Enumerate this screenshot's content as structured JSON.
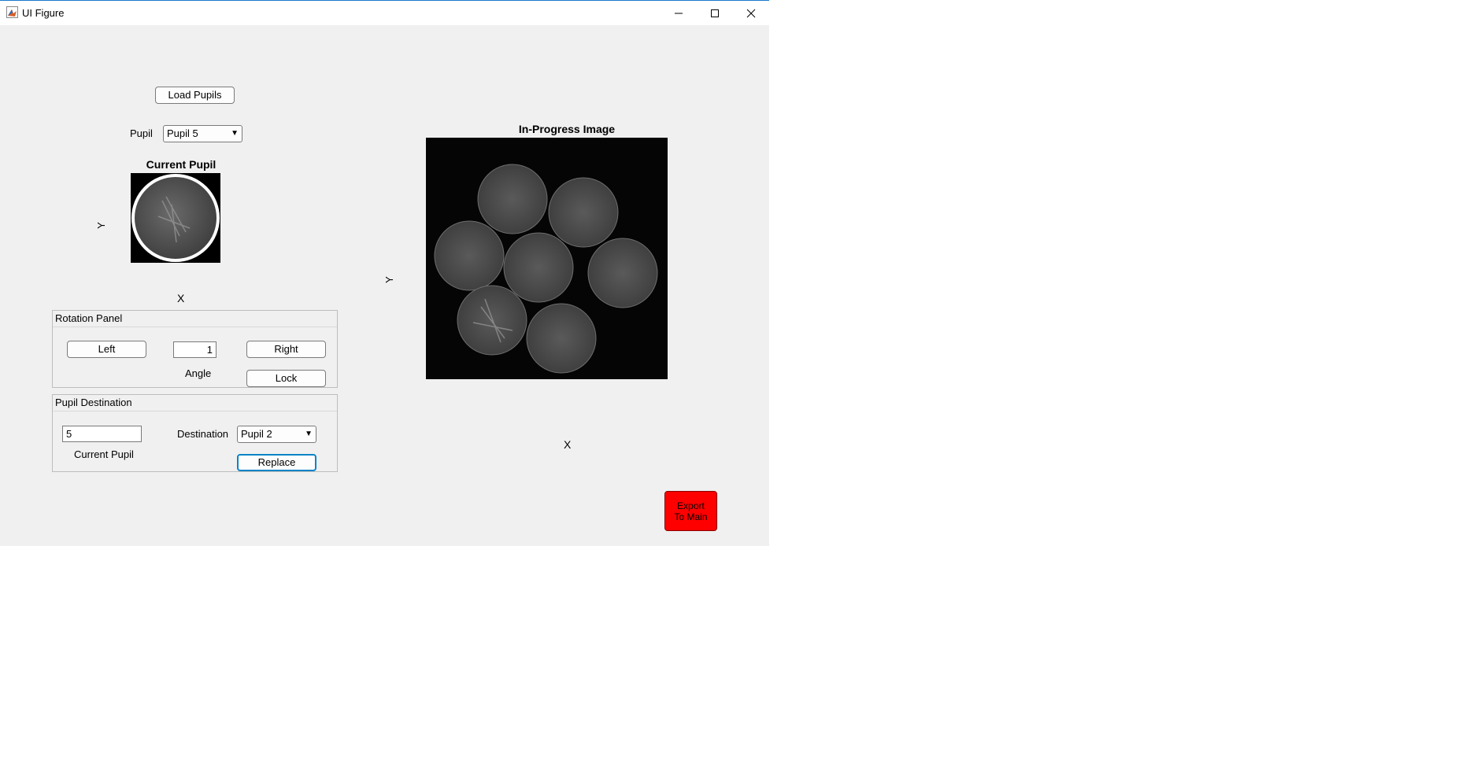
{
  "window": {
    "title": "UI Figure",
    "controls": {
      "minimize_icon": "minimize-icon",
      "maximize_icon": "maximize-icon",
      "close_icon": "close-icon"
    }
  },
  "load_button": {
    "label": "Load Pupils"
  },
  "pupil_select": {
    "label": "Pupil",
    "value": "Pupil 5"
  },
  "current_axes": {
    "title": "Current Pupil",
    "xlabel": "X",
    "ylabel": "Y"
  },
  "rotation_panel": {
    "title": "Rotation Panel",
    "left_label": "Left",
    "angle_value": "1",
    "angle_label": "Angle",
    "right_label": "Right",
    "lock_label": "Lock"
  },
  "destination_panel": {
    "title": "Pupil Destination",
    "current_value": "5",
    "current_label": "Current Pupil",
    "destination_label": "Destination",
    "destination_value": "Pupil 2",
    "replace_label": "Replace"
  },
  "progress_axes": {
    "title": "In-Progress Image",
    "xlabel": "X",
    "ylabel": "Y"
  },
  "export_button": {
    "label": "Export To Main",
    "color": "#ff0000"
  }
}
